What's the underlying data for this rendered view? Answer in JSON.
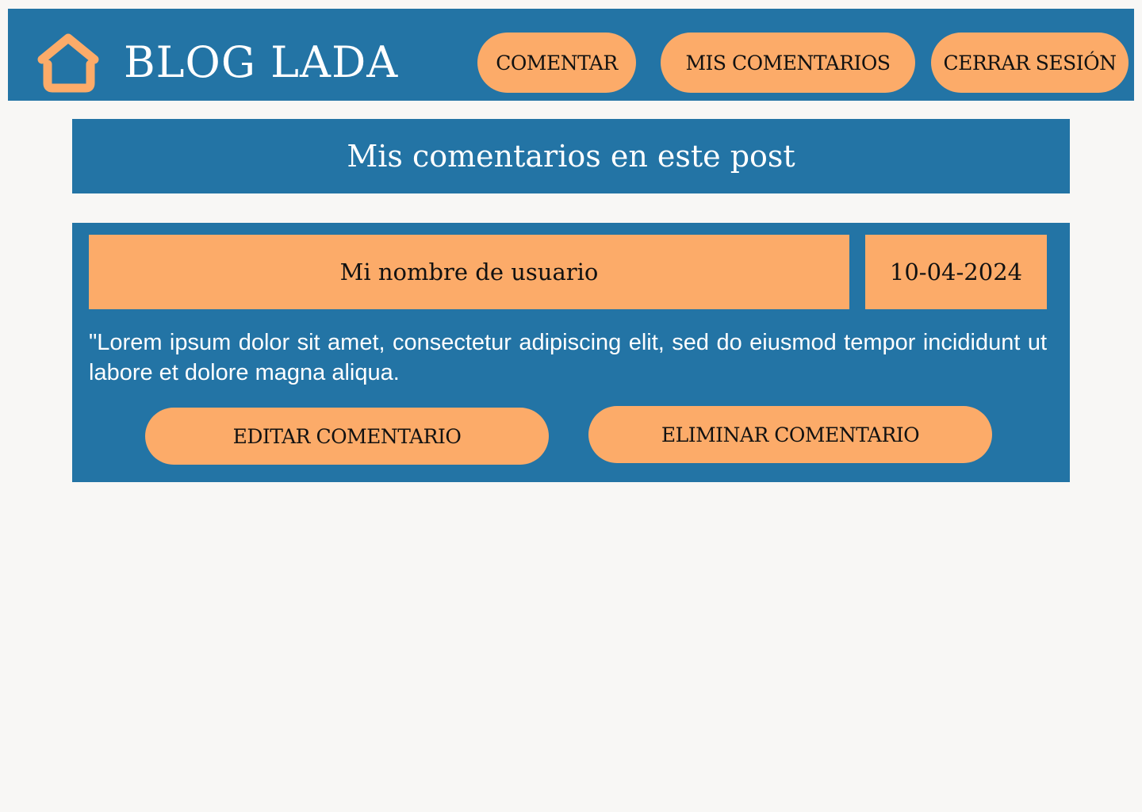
{
  "header": {
    "brand": "BLOG LADA",
    "home_icon": "home-icon",
    "nav": [
      {
        "label": "COMENTAR"
      },
      {
        "label": "MIS COMENTARIOS"
      },
      {
        "label": "CERRAR SESIÓN"
      }
    ]
  },
  "page": {
    "title": "Mis comentarios en este post"
  },
  "comments": [
    {
      "username": "Mi nombre de usuario",
      "date": "10-04-2024",
      "text": "\"Lorem ipsum dolor sit amet, consectetur adipiscing elit, sed do eiusmod tempor incididunt ut labore et dolore magna aliqua.",
      "edit_label": "EDITAR COMENTARIO",
      "delete_label": "ELIMINAR COMENTARIO"
    }
  ],
  "colors": {
    "primary": "#2374a5",
    "accent": "#fcab69",
    "background": "#f8f7f5",
    "text_dark": "#111111",
    "text_light": "#ffffff"
  }
}
